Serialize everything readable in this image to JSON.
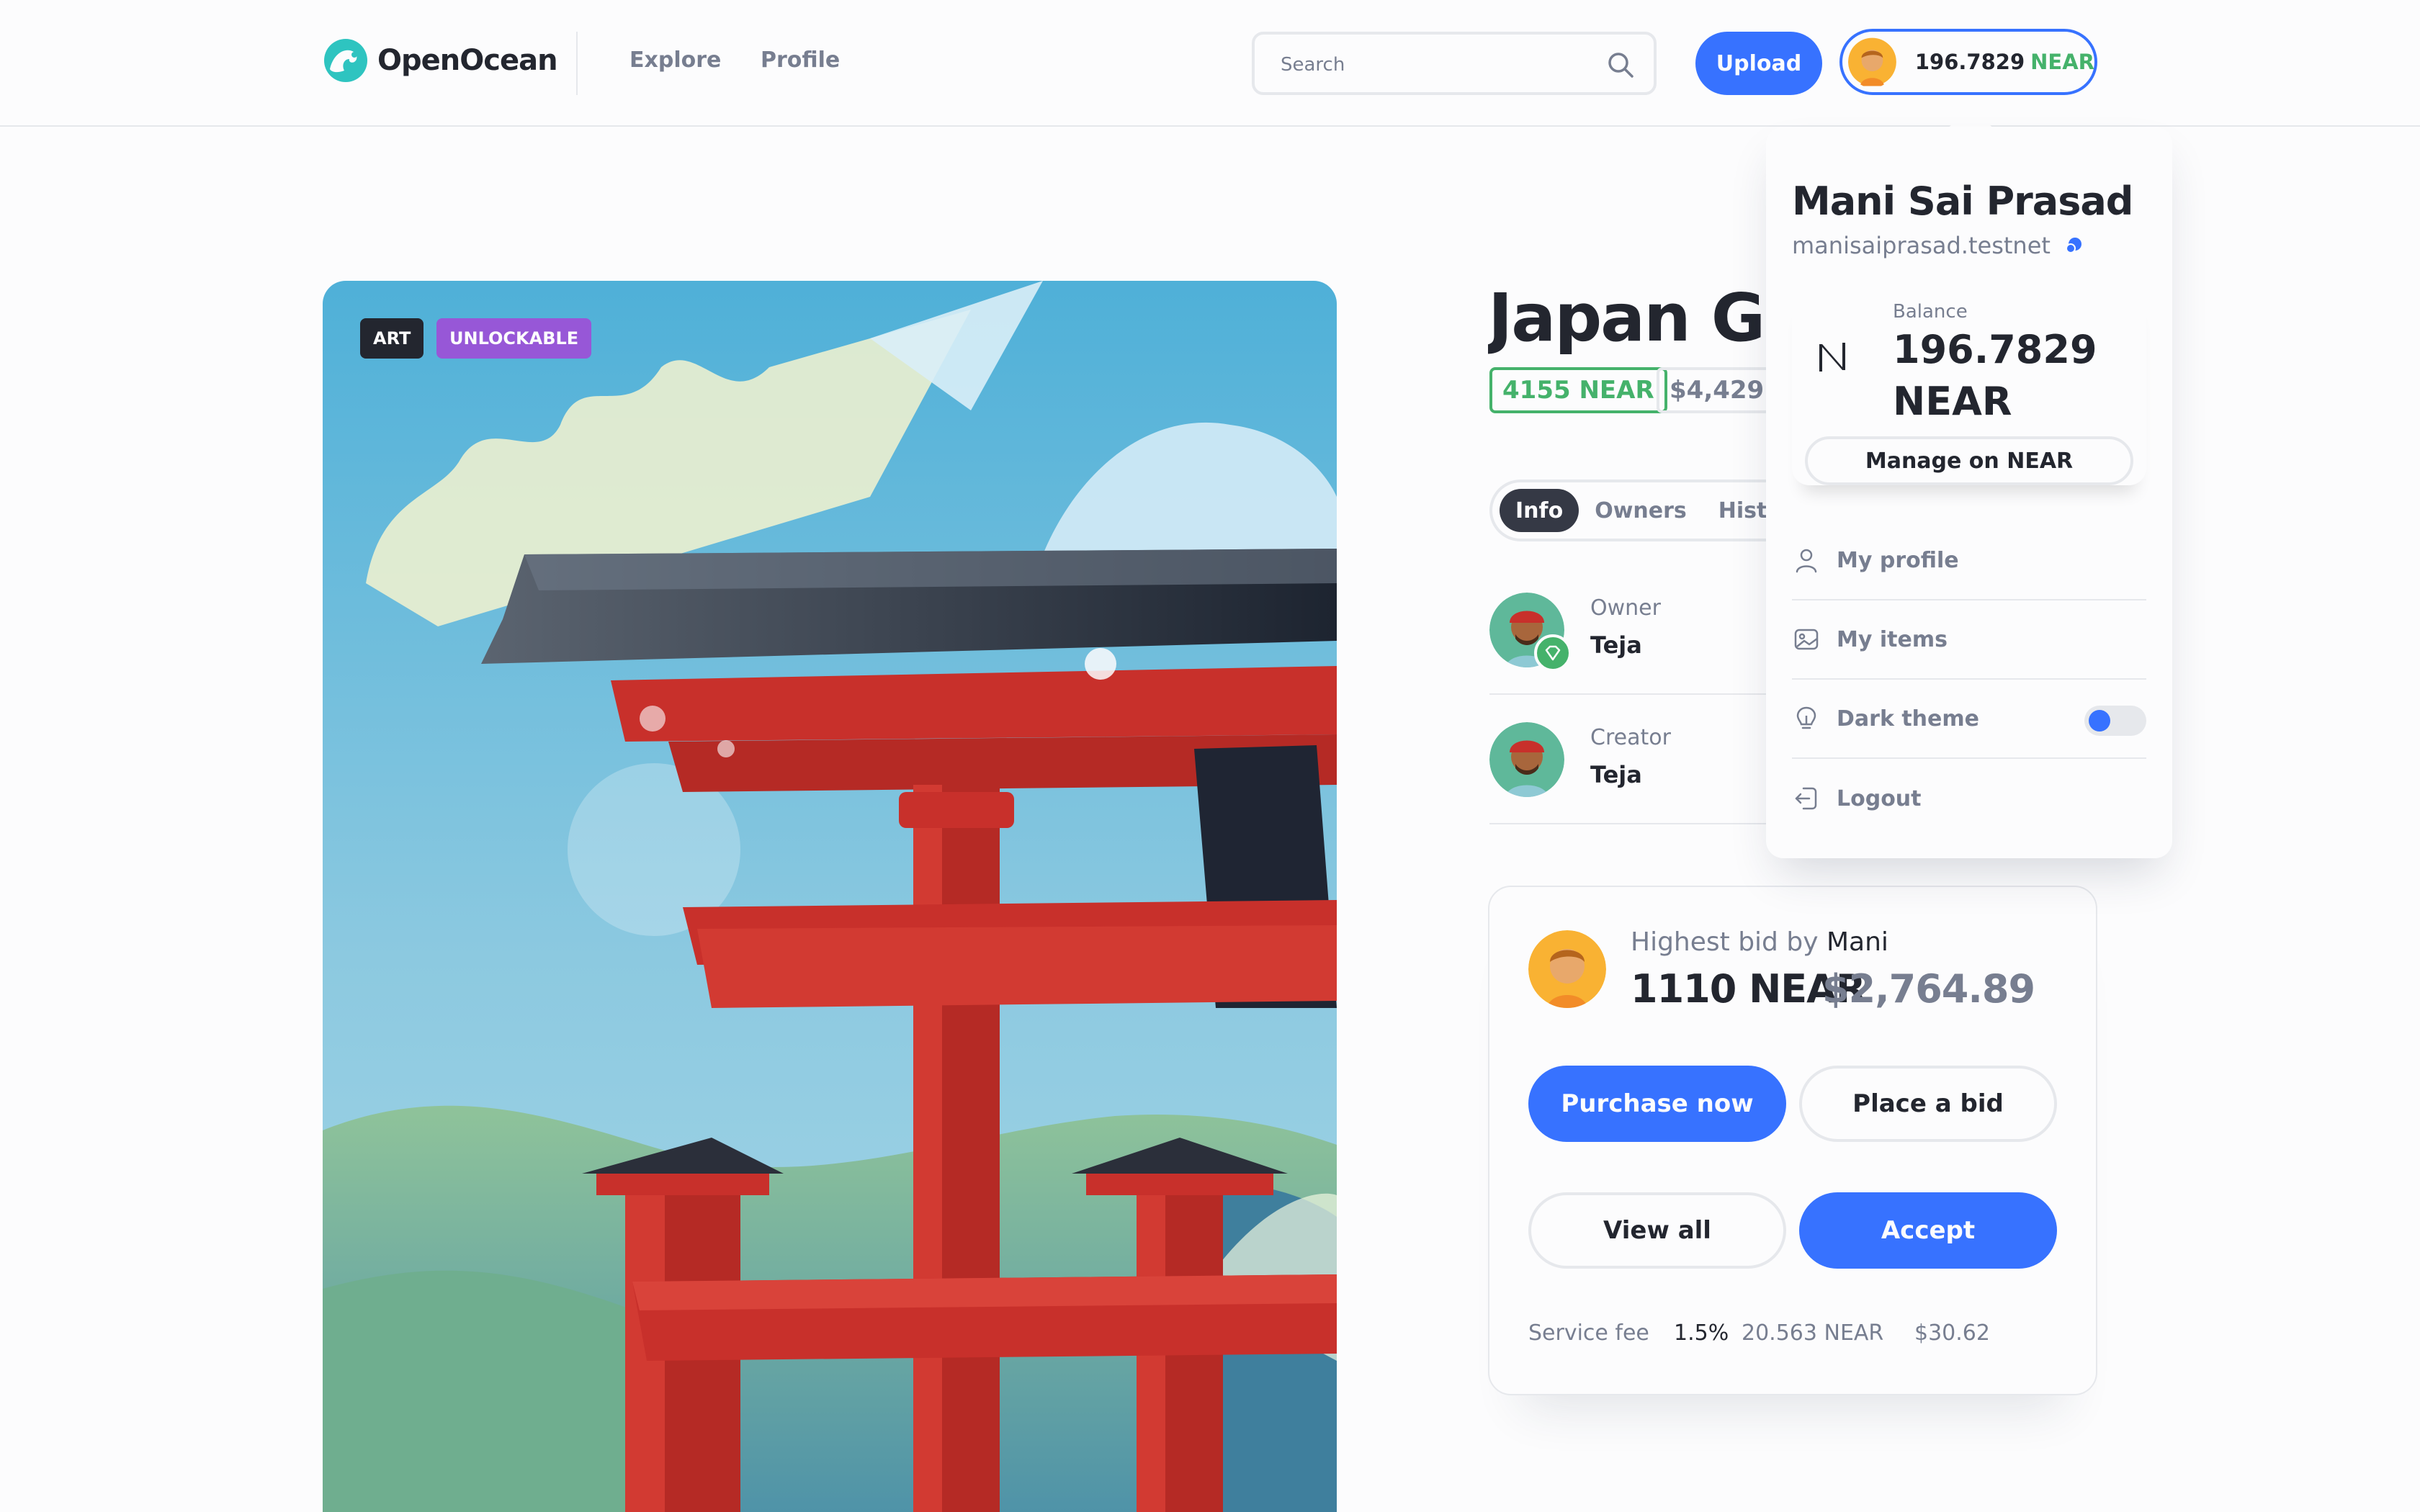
{
  "header": {
    "logo_text": "OpenOcean",
    "nav": [
      "Explore",
      "Profile"
    ],
    "search_placeholder": "Search",
    "upload_label": "Upload",
    "wallet": {
      "amount": "196.7829",
      "currency": "NEAR"
    }
  },
  "artwork": {
    "tags": [
      "ART",
      "UNLOCKABLE"
    ]
  },
  "item": {
    "title": "Japan Great Torii",
    "price_near": "4155 NEAR",
    "price_usd": "$4,429.87",
    "tabs": [
      "Info",
      "Owners",
      "History"
    ],
    "active_tab": "Info",
    "owner": {
      "role": "Owner",
      "name": "Teja"
    },
    "creator": {
      "role": "Creator",
      "name": "Teja"
    }
  },
  "bid": {
    "label_prefix": "Highest bid by",
    "bidder": "Mani",
    "amount": "1110 NEAR",
    "amount_usd": "$2,764.89",
    "buttons": {
      "purchase": "Purchase now",
      "place_bid": "Place a bid",
      "view_all": "View all",
      "accept": "Accept"
    },
    "fee": {
      "label": "Service fee",
      "percent": "1.5%",
      "near": "20.563 NEAR",
      "usd": "$30.62"
    }
  },
  "dropdown": {
    "name": "Mani Sai Prasad",
    "account": "manisaiprasad.testnet",
    "balance_label": "Balance",
    "balance_value": "196.7829 NEAR",
    "manage_label": "Manage on NEAR",
    "menu": {
      "my_profile": "My profile",
      "my_items": "My items",
      "dark_theme": "Dark theme",
      "logout": "Logout"
    },
    "dark_theme_enabled": false
  },
  "colors": {
    "accent": "#3772ff",
    "green": "#45b26b",
    "purple": "#9757d7",
    "dark": "#23262f",
    "muted": "#777e90"
  }
}
